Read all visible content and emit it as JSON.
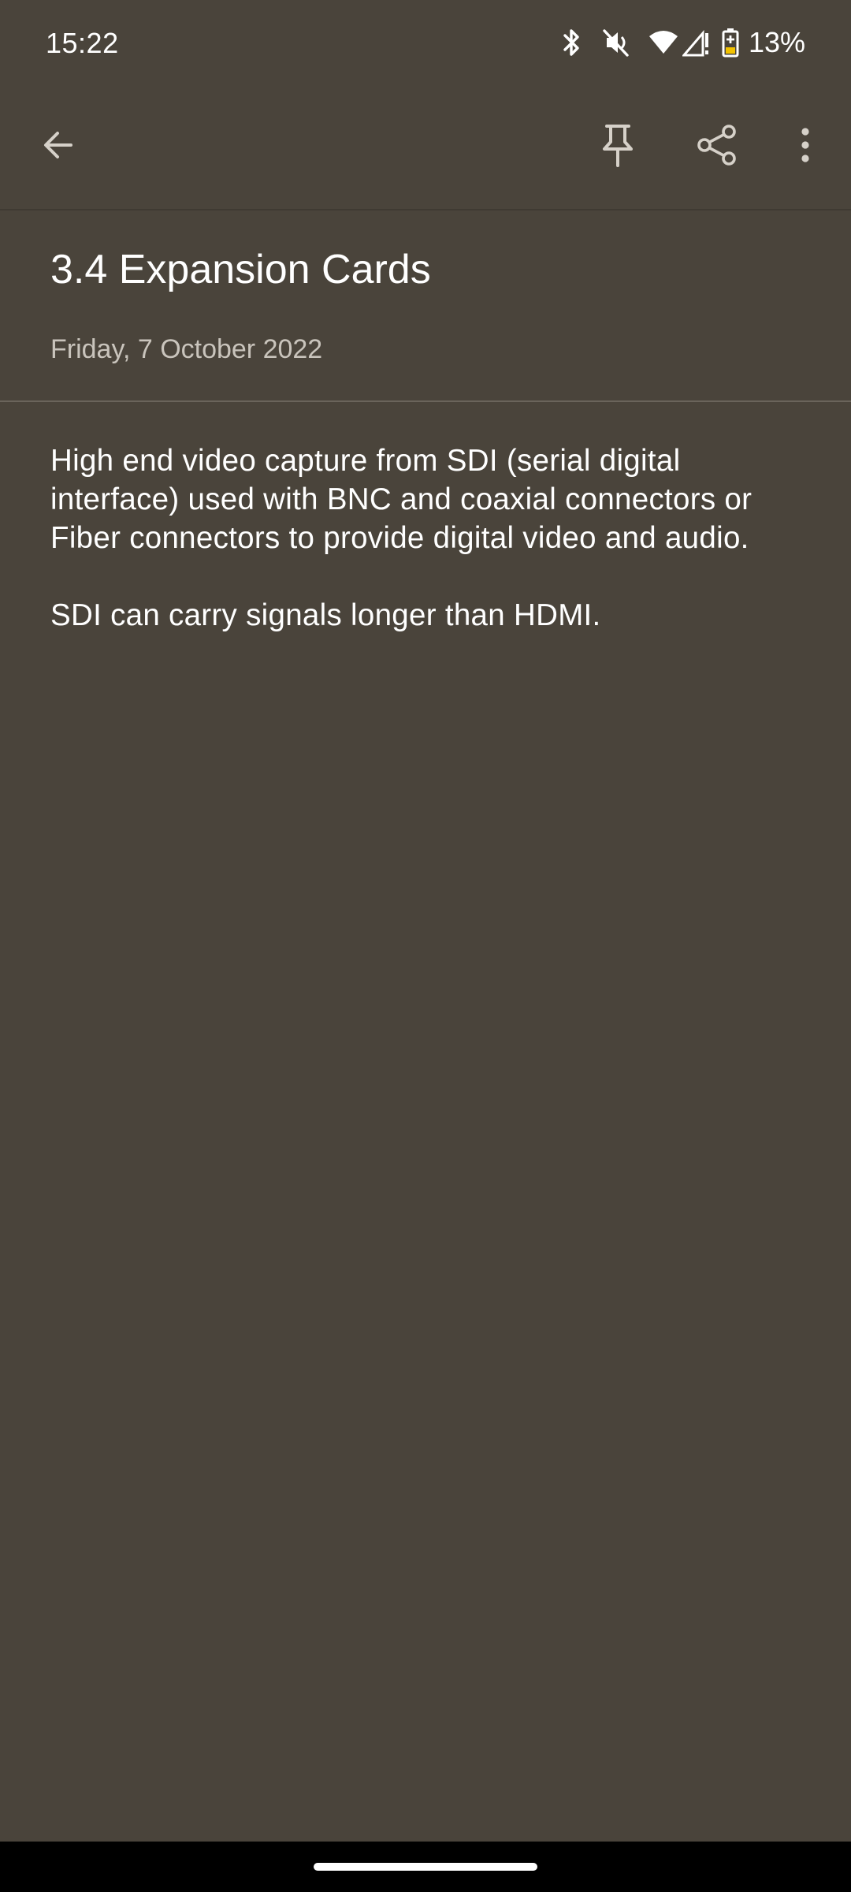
{
  "status_bar": {
    "time": "15:22",
    "icons": [
      "bluetooth-icon",
      "mute-icon",
      "wifi-icon",
      "signal-icon",
      "battery-icon"
    ],
    "battery_percent": "13%"
  },
  "app_bar": {
    "actions": [
      "back-arrow-icon",
      "pin-icon",
      "share-icon",
      "more-vert-icon"
    ]
  },
  "note": {
    "title": "3.4 Expansion Cards",
    "date": "Friday, 7 October 2022",
    "paragraphs": [
      "High end video capture from SDI (serial digital interface) used with BNC and coaxial connectors or Fiber connectors to provide digital video and audio.",
      "SDI can carry signals longer than HDMI."
    ]
  },
  "colors": {
    "background": "#4a443b",
    "text": "#ffffff",
    "secondary_text": "#c9c4bc",
    "nav_bar": "#000000"
  }
}
